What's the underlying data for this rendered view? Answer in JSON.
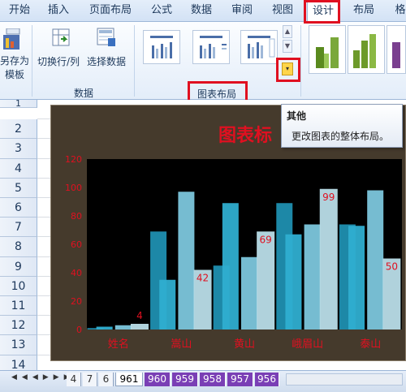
{
  "ribbon_tabs": [
    "开始",
    "插入",
    "页面布局",
    "公式",
    "数据",
    "审阅",
    "视图",
    "设计",
    "布局",
    "格"
  ],
  "ribbon": {
    "save_template": [
      "另存为",
      "模板"
    ],
    "switch_row_col": "切换行/列",
    "select_data": "选择数据",
    "group_data": "数据",
    "group_layout": "图表布局"
  },
  "tooltip": {
    "title": "其他",
    "desc": "更改图表的整体布局。"
  },
  "rows": [
    "1",
    "2",
    "3",
    "4",
    "5",
    "6",
    "7",
    "8",
    "9",
    "10",
    "11",
    "12",
    "13",
    "14"
  ],
  "chart_data": {
    "type": "bar",
    "title": "图表标",
    "categories": [
      "姓名",
      "嵩山",
      "黄山",
      "峨眉山",
      "泰山"
    ],
    "ylim": [
      0,
      120
    ],
    "yticks": [
      "0",
      "20",
      "40",
      "60",
      "80",
      "100",
      "120"
    ],
    "series": [
      {
        "values": [
          1,
          69,
          45,
          89,
          74
        ]
      },
      {
        "values": [
          2,
          35,
          89,
          67,
          73
        ]
      },
      {
        "values": [
          3,
          97,
          51,
          74,
          98
        ]
      },
      {
        "values": [
          4,
          42,
          69,
          99,
          50
        ]
      }
    ],
    "data_labels": [
      "4",
      "42",
      "69",
      "99",
      "50"
    ],
    "colors": [
      "#1f8fb0",
      "#2faed0",
      "#7cc6dc",
      "#b9dde8"
    ],
    "background": "#000000",
    "title_color": "#e01020",
    "label_color": "#e01020"
  },
  "sheet_tabs": [
    "4",
    "7",
    "6",
    "961",
    "960",
    "959",
    "958",
    "957",
    "956"
  ],
  "colors": {
    "highlight": "#e01020",
    "accent_purple": "#7a3fb5"
  }
}
